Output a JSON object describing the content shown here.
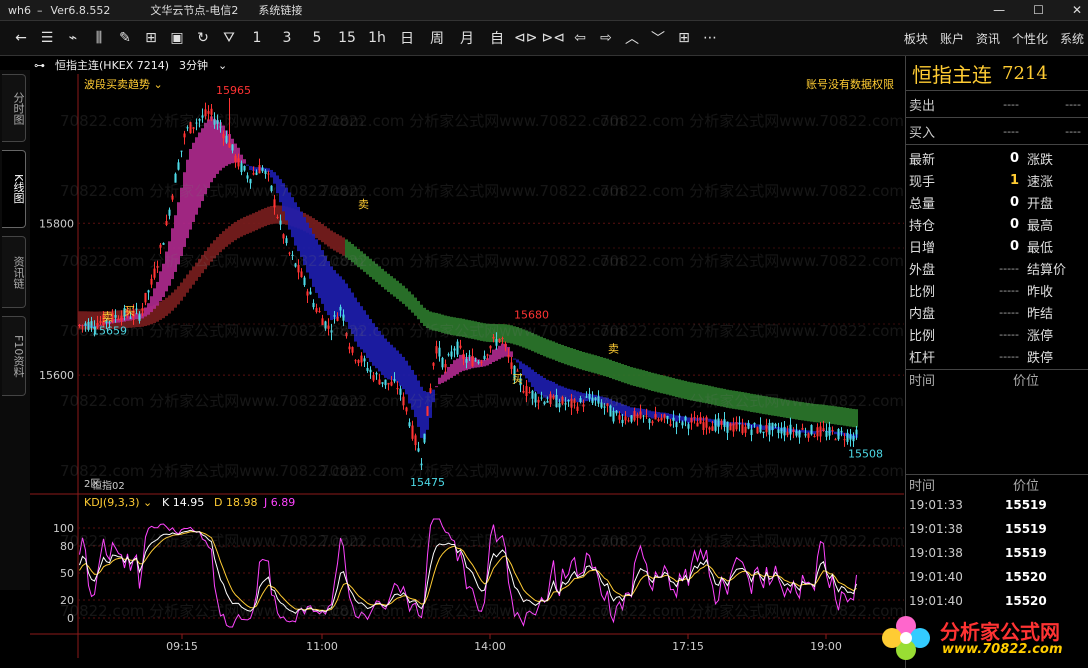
{
  "titlebar": {
    "app": "wh6",
    "version": "Ver6.8.552",
    "server": "文华云节点-电信2",
    "menu": "系统链接"
  },
  "toolbar": {
    "buttons": [
      "1",
      "3",
      "5",
      "15",
      "1h",
      "日",
      "周",
      "月",
      "自"
    ],
    "right": [
      "板块",
      "账户",
      "资讯",
      "个性化",
      "系统"
    ]
  },
  "left_tabs": [
    "分时图",
    "K线图",
    "资讯链",
    "F10资料"
  ],
  "chart_header": {
    "symbol": "恒指主连(HKEX 7214)",
    "period": "3分钟",
    "indicator": "波段买卖趋势",
    "notice": "账号没有数据权限"
  },
  "sub_header": {
    "name": "KDJ(9,3,3)",
    "k": "K 14.95",
    "d": "D 18.98",
    "j": "J 6.89",
    "tag": "恒指02",
    "tag2": "2区"
  },
  "price_axis": [
    "15800",
    "15600"
  ],
  "kdj_axis": [
    "100",
    "80",
    "50",
    "20",
    "0"
  ],
  "time_axis": [
    "09:15",
    "11:00",
    "14:00",
    "17:15",
    "19:00"
  ],
  "annotations": {
    "high": "15965",
    "low": "15475",
    "last_low": "15508",
    "start": "15659",
    "mid": "15680",
    "buy": "买",
    "sell": "卖"
  },
  "quote": {
    "name": "恒指主连",
    "code": "7214",
    "sell_label": "卖出",
    "sell_val": "----",
    "sell_vol": "----",
    "buy_label": "买入",
    "buy_val": "----",
    "buy_vol": "----",
    "rows": [
      {
        "l": "最新",
        "v": "0",
        "r": "涨跌"
      },
      {
        "l": "现手",
        "v": "1",
        "r": "速涨"
      },
      {
        "l": "总量",
        "v": "0",
        "r": "开盘"
      },
      {
        "l": "持仓",
        "v": "0",
        "r": "最高"
      },
      {
        "l": "日增",
        "v": "0",
        "r": "最低"
      },
      {
        "l": "外盘",
        "v": "-----",
        "r": "结算价"
      },
      {
        "l": "比例",
        "v": "-----",
        "r": "昨收"
      },
      {
        "l": "内盘",
        "v": "-----",
        "r": "昨结"
      },
      {
        "l": "比例",
        "v": "-----",
        "r": "涨停"
      },
      {
        "l": "杠杆",
        "v": "-----",
        "r": "跌停"
      }
    ],
    "time_col": "时间",
    "price_col": "价位",
    "ticks": [
      {
        "t": "19:01:33",
        "p": "15519"
      },
      {
        "t": "19:01:38",
        "p": "15519"
      },
      {
        "t": "19:01:38",
        "p": "15519"
      },
      {
        "t": "19:01:40",
        "p": "15520"
      },
      {
        "t": "19:01:40",
        "p": "15520"
      }
    ]
  },
  "logo": {
    "text1": "分析家公式网",
    "text2": "www.70822.com"
  },
  "watermark": "70822.com 分析家公式网www.70822.com",
  "colors": {
    "up": "#ff3333",
    "down": "#4dd9e6",
    "gold": "#ffcc33",
    "magenta": "#ff44ff",
    "green": "#2a7a2a",
    "blue": "#1a1aa0"
  }
}
